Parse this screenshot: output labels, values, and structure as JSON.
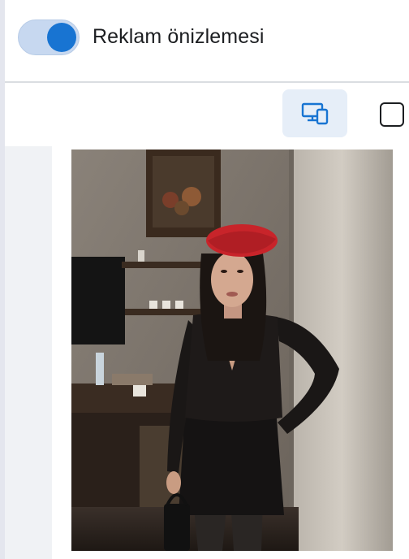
{
  "header": {
    "toggle_state": "on",
    "title": "Reklam önizlemesi"
  },
  "toolbar": {
    "desktop_icon": "desktop-mobile-icon",
    "mobile_icon": "square-icon",
    "selected": "desktop"
  },
  "colors": {
    "accent": "#1874d2",
    "toggle_track": "#c7d8f0",
    "selected_bg": "#e6eef8",
    "preview_bg": "#f0f2f5"
  },
  "preview": {
    "image_subject": "woman-in-red-beret-black-lace-outfit"
  }
}
